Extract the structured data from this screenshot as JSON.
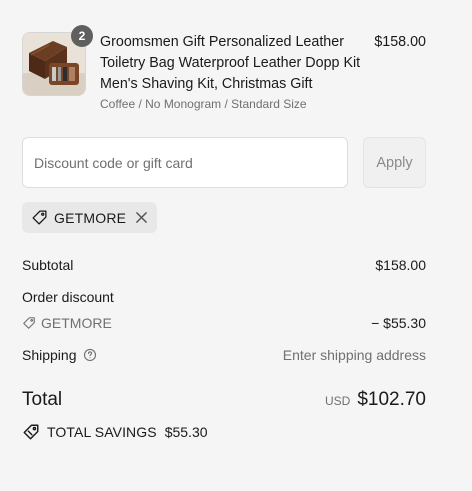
{
  "product": {
    "quantity": "2",
    "title": "Groomsmen Gift Personalized Leather Toiletry Bag Waterproof Leather Dopp Kit Men's Shaving Kit, Christmas Gift",
    "variant": "Coffee / No Monogram / Standard Size",
    "price": "$158.00"
  },
  "discount": {
    "placeholder": "Discount code or gift card",
    "apply_label": "Apply",
    "applied_code": "GETMORE"
  },
  "summary": {
    "subtotal_label": "Subtotal",
    "subtotal_value": "$158.00",
    "order_discount_label": "Order discount",
    "discount_code": "GETMORE",
    "discount_value": "− $55.30",
    "shipping_label": "Shipping",
    "shipping_value": "Enter shipping address",
    "total_label": "Total",
    "currency": "USD",
    "total_value": "$102.70",
    "savings_label": "TOTAL SAVINGS",
    "savings_value": "$55.30"
  }
}
